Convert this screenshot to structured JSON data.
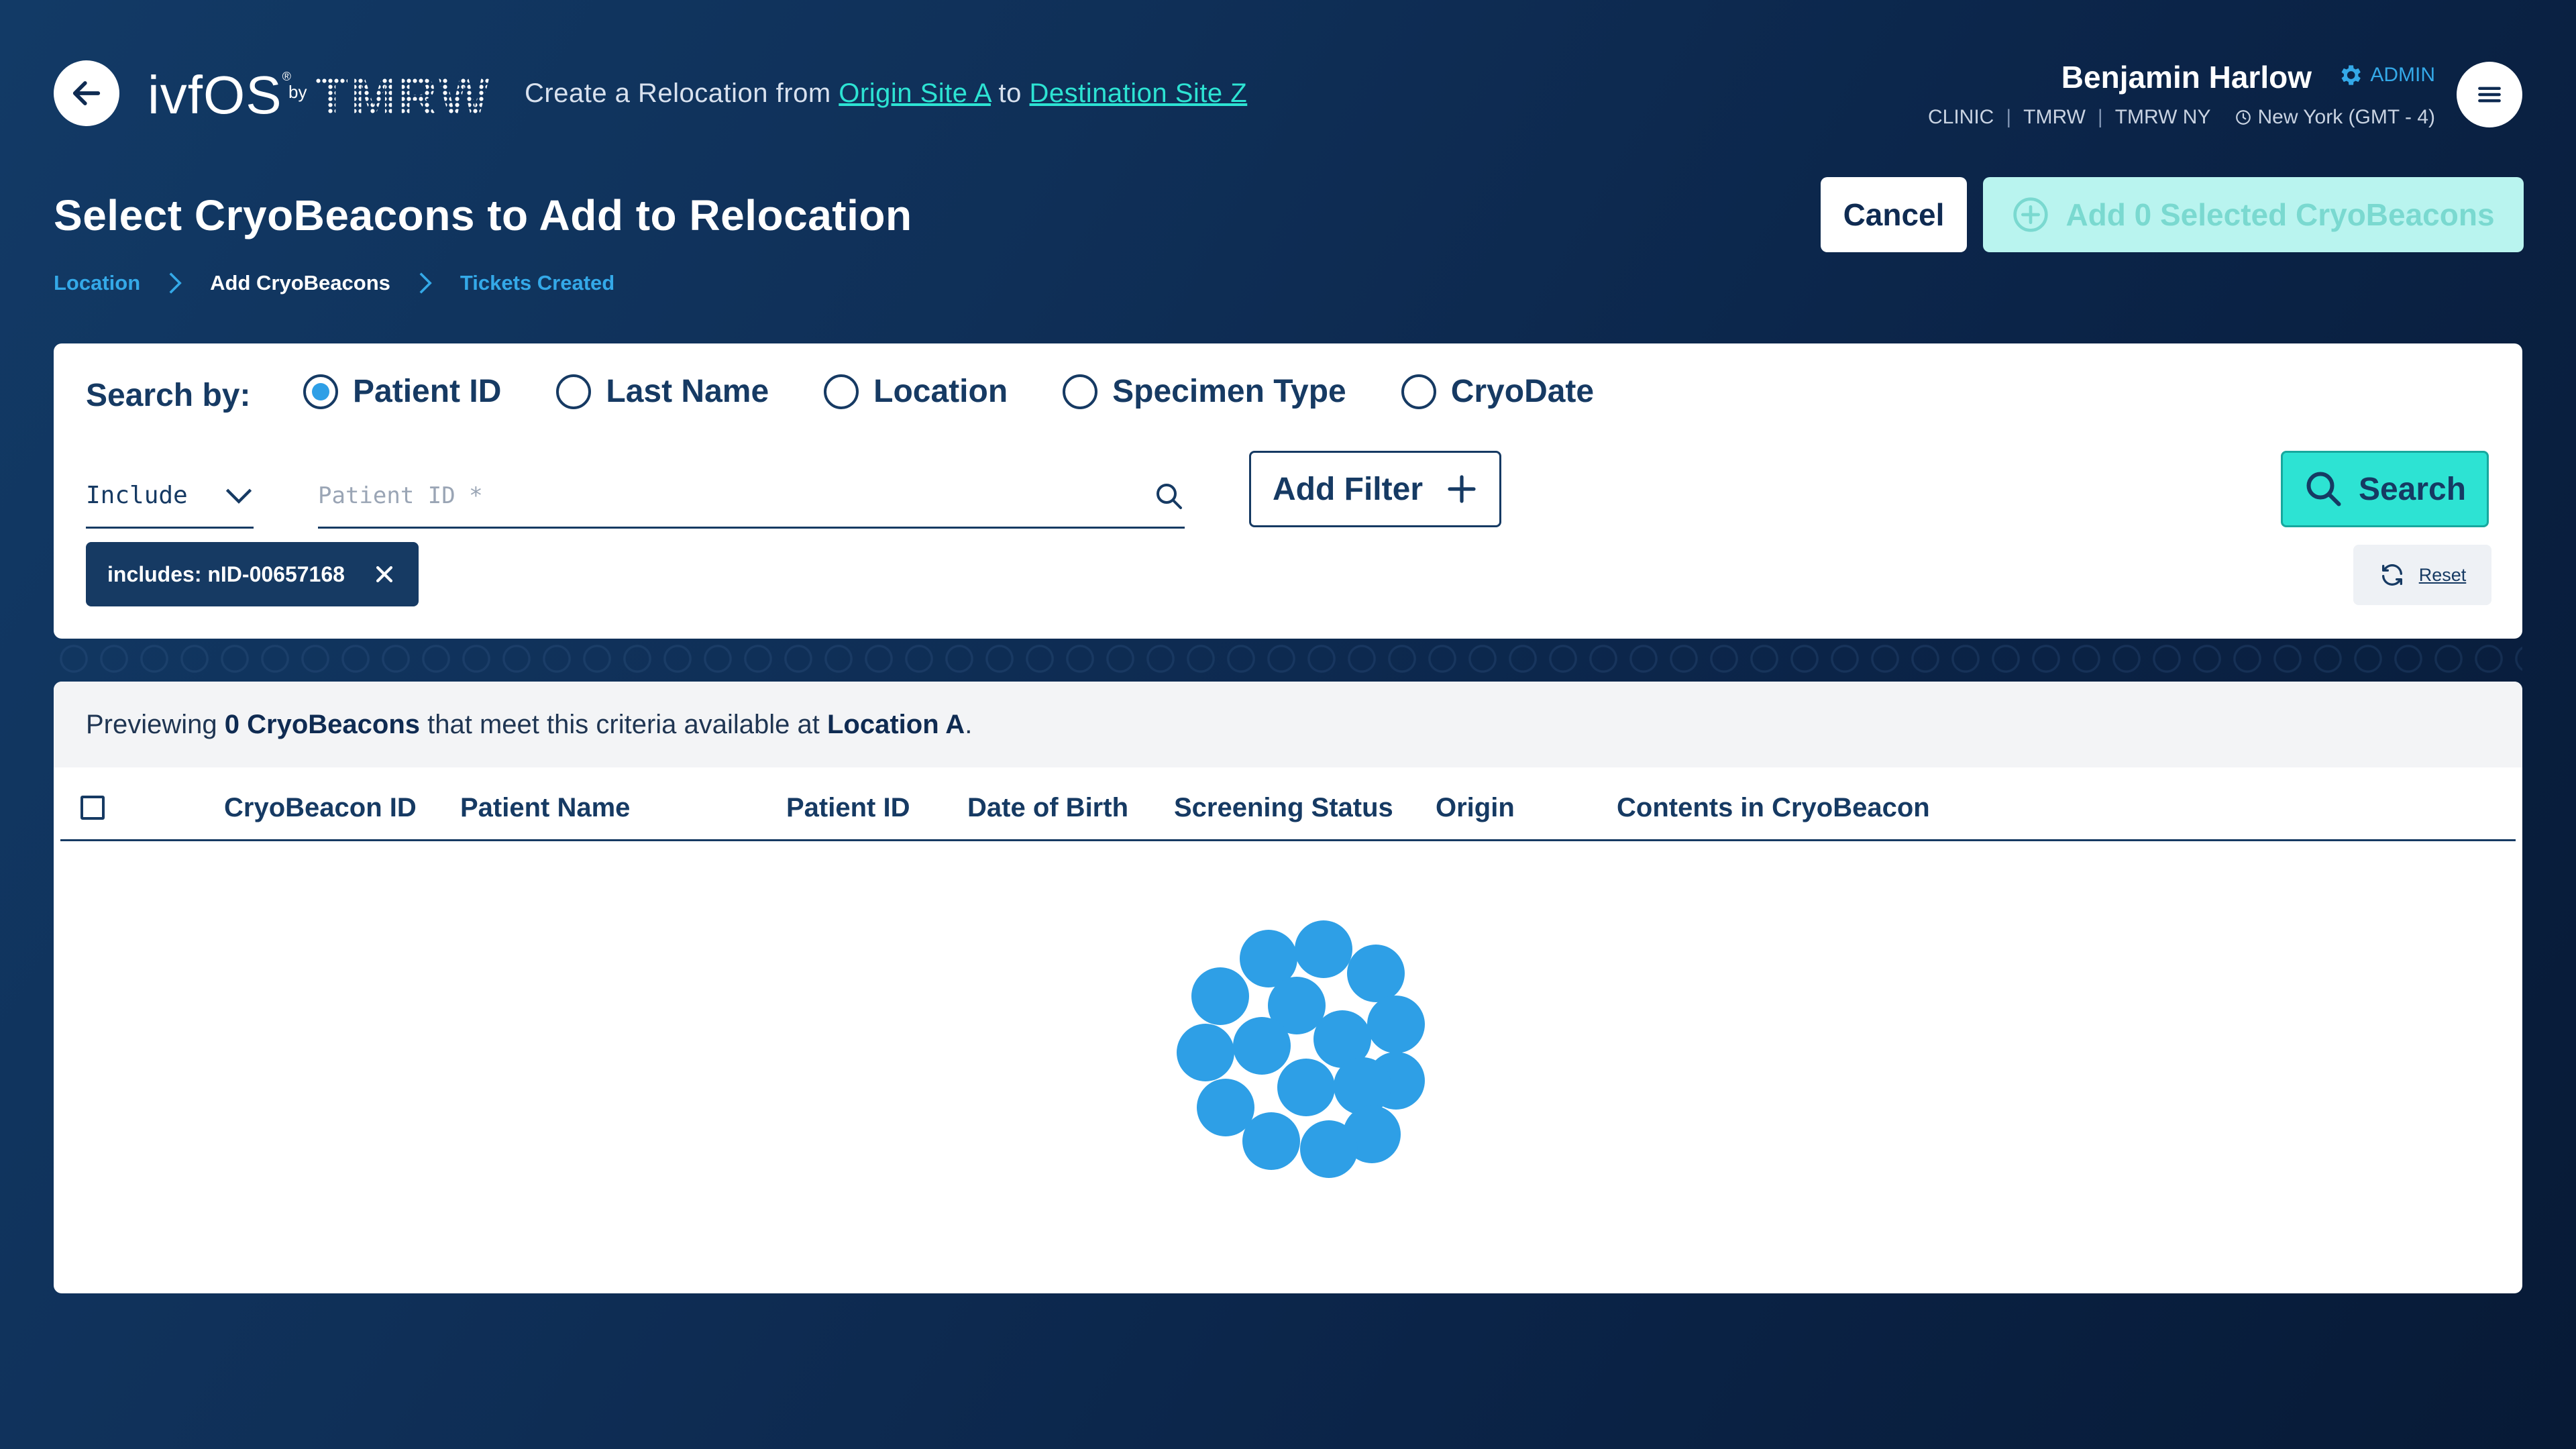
{
  "header": {
    "brand_ivf": "ivfOS",
    "brand_reg": "®",
    "brand_by": "by",
    "brand_tmrw": "TMRW",
    "sub_prefix": "Create a Relocation from",
    "origin_link": "Origin Site A",
    "sub_mid": "to",
    "destination_link": "Destination Site Z",
    "user_name": "Benjamin Harlow",
    "role": "ADMIN",
    "meta": [
      "CLINIC",
      "TMRW",
      "TMRW NY"
    ],
    "timezone": "New York (GMT - 4)"
  },
  "title": {
    "text": "Select CryoBeacons to Add to Relocation",
    "cancel_label": "Cancel",
    "add_label": "Add 0 Selected CryoBeacons"
  },
  "breadcrumb": {
    "items": [
      "Location",
      "Add CryoBeacons",
      "Tickets Created"
    ]
  },
  "search": {
    "label": "Search by:",
    "options": [
      "Patient ID",
      "Last Name",
      "Location",
      "Specimen Type",
      "CryoDate"
    ],
    "selected": "Patient ID",
    "include_value": "Include",
    "input_placeholder": "Patient ID *",
    "input_value": "",
    "add_filter_label": "Add Filter",
    "search_label": "Search",
    "chip_label": "includes: nID-00657168",
    "reset_label": "Reset"
  },
  "results": {
    "prefix": "Previewing",
    "count_text": "0 CryoBeacons",
    "middle": "that meet this criteria available at",
    "location": "Location A",
    "suffix": ".",
    "columns": [
      "CryoBeacon ID",
      "Patient Name",
      "Patient ID",
      "Date of Birth",
      "Screening Status",
      "Origin",
      "Contents in CryoBeacon"
    ]
  },
  "colors": {
    "accent_teal": "#2de3d3",
    "accent_blue": "#2e9fe6",
    "navy": "#163a63"
  }
}
